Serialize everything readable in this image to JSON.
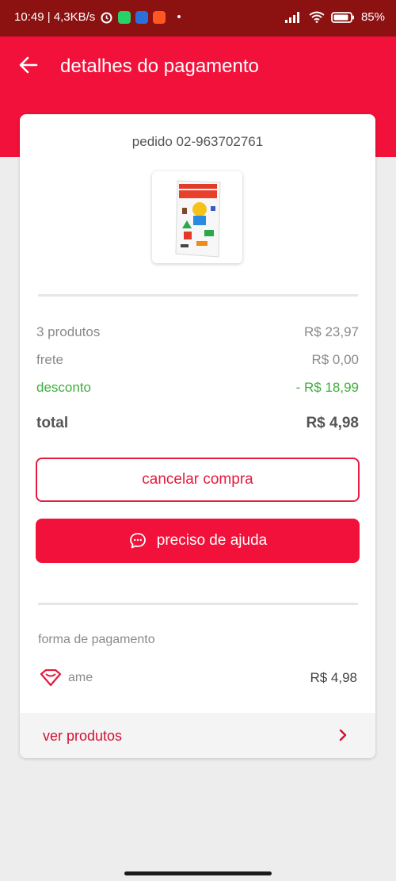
{
  "status_bar": {
    "time_speed": "10:49 | 4,3KB/s",
    "dot": "•",
    "battery": "85%"
  },
  "header": {
    "title": "detalhes do pagamento"
  },
  "order": {
    "id_text": "pedido 02-963702761",
    "product_image_alt": "chamequinho"
  },
  "summary": {
    "products_label": "3 produtos",
    "products_value": "R$ 23,97",
    "shipping_label": "frete",
    "shipping_value": "R$ 0,00",
    "discount_label": "desconto",
    "discount_value": "- R$ 18,99",
    "total_label": "total",
    "total_value": "R$ 4,98"
  },
  "actions": {
    "cancel_label": "cancelar compra",
    "help_label": "preciso de ajuda"
  },
  "payment": {
    "section_label": "forma de pagamento",
    "method": "ame",
    "amount": "R$ 4,98"
  },
  "footer": {
    "see_products_label": "ver produtos"
  },
  "colors": {
    "brand_red": "#f2113a",
    "status_bar": "#8c1212",
    "discount_green": "#3dae3d"
  }
}
